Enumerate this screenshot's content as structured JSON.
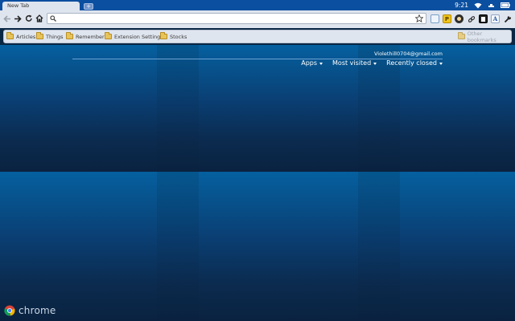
{
  "tab": {
    "title": "New Tab"
  },
  "status": {
    "clock": "9:21"
  },
  "omnibox": {
    "value": ""
  },
  "extensions": [
    {
      "name": "page-icon",
      "glyph": ""
    },
    {
      "name": "notes-icon",
      "glyph": "P"
    },
    {
      "name": "user-icon",
      "glyph": ""
    },
    {
      "name": "link-icon",
      "glyph": ""
    },
    {
      "name": "document-icon",
      "glyph": ""
    },
    {
      "name": "text-icon",
      "glyph": "A"
    }
  ],
  "bookmarks": {
    "items": [
      {
        "label": "Articles"
      },
      {
        "label": "Things"
      },
      {
        "label": "Remember"
      },
      {
        "label": "Extension Settings"
      },
      {
        "label": "Stocks"
      }
    ],
    "other": "Other bookmarks"
  },
  "ntp": {
    "user": "Violethill0704@gmail.com",
    "menus": [
      {
        "label": "Apps"
      },
      {
        "label": "Most visited"
      },
      {
        "label": "Recently closed"
      }
    ]
  },
  "brand": {
    "label": "chrome"
  },
  "colors": {
    "accent": "#0b4fa0",
    "background": "#0a2744"
  }
}
